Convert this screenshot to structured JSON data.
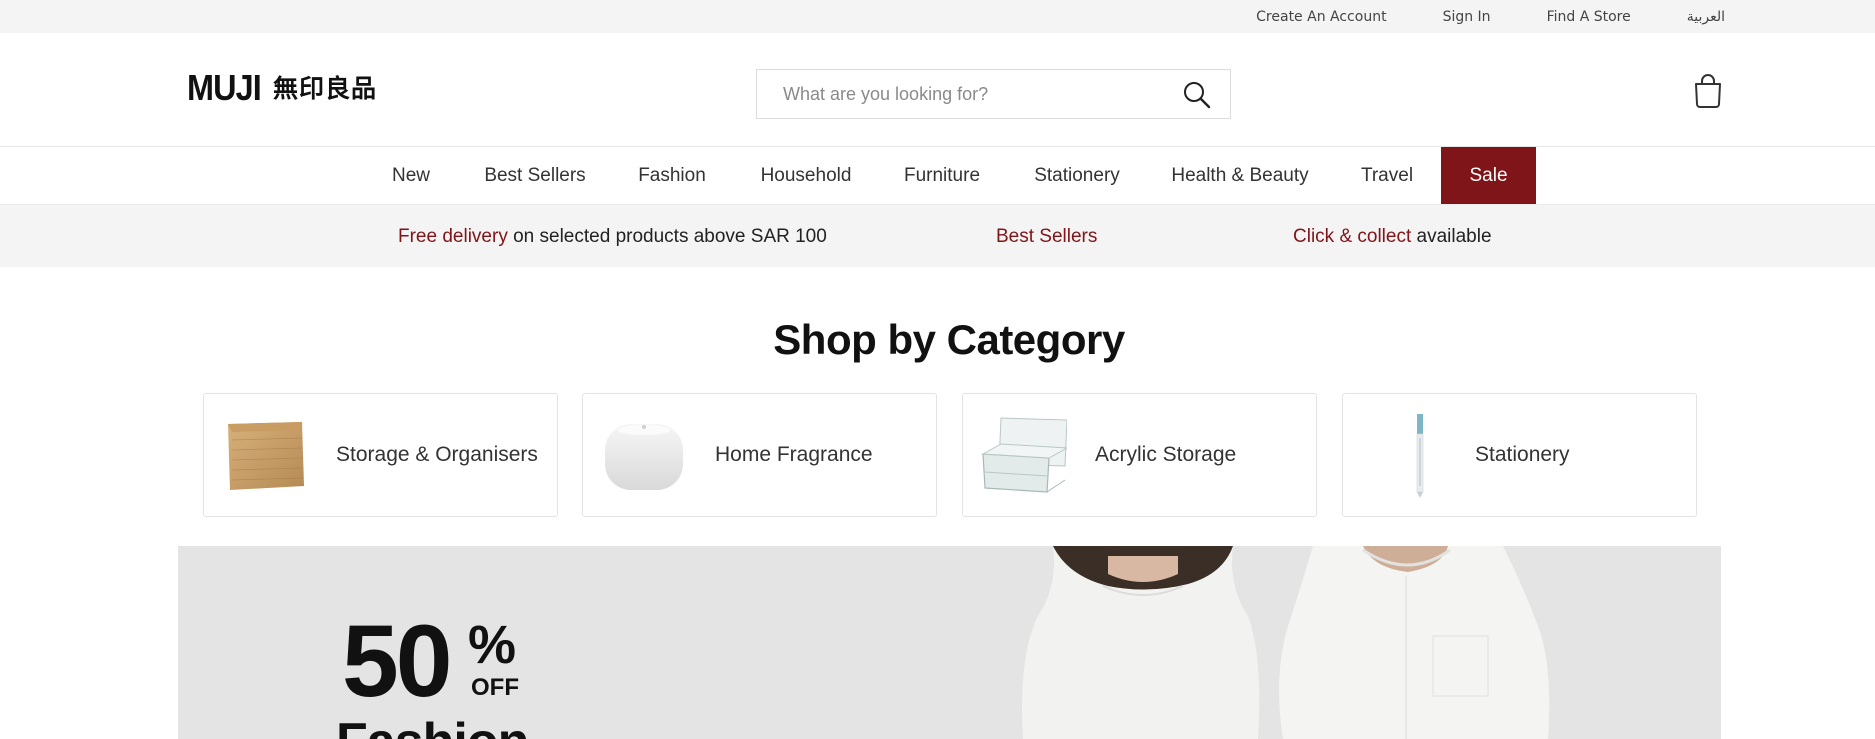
{
  "util_bar": {
    "links": [
      "Create An Account",
      "Sign In",
      "Find A Store",
      "العربية"
    ]
  },
  "header": {
    "logo_text": "MUJI",
    "logo_kanji": "無印良品",
    "search_placeholder": "What are you looking for?",
    "search_icon": "search-icon",
    "cart_icon": "shopping-bag-icon"
  },
  "nav": {
    "items": [
      "New",
      "Best Sellers",
      "Fashion",
      "Household",
      "Furniture",
      "Stationery",
      "Health & Beauty",
      "Travel",
      "Sale"
    ]
  },
  "promo": {
    "delivery_highlight": "Free delivery",
    "delivery_text": " on selected products above SAR 100",
    "bestsellers": "Best Sellers",
    "collect_highlight": "Click & collect",
    "collect_text": " available"
  },
  "categories": {
    "title": "Shop by Category",
    "items": [
      "Storage & Organisers",
      "Home Fragrance",
      "Acrylic Storage",
      "Stationery"
    ]
  },
  "hero": {
    "percent": "50",
    "percent_symbol": "%",
    "off": "OFF",
    "category": "Fashion"
  },
  "colors": {
    "accent": "#7f1518",
    "util_bg": "#f4f4f4",
    "hero_bg": "#e3e4e3"
  }
}
